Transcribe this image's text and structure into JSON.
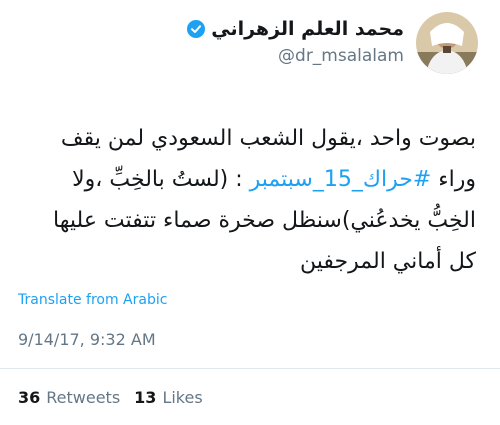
{
  "author": {
    "display_name": "محمد العلم الزهراني",
    "handle": "@dr_msalalam",
    "verified": true,
    "avatar_icon": "profile-photo"
  },
  "tweet": {
    "text_before_hashtag": "بصوت واحد ،يقول الشعب السعودي لمن يقف وراء",
    "hashtag": "#حراك_15_سبتمبر",
    "text_after_hashtag": ": (لستُ بالخِبِّ ،ولا الخِبُّ يخدعُني)سنظل صخرة صماء تتفتت عليها كل أماني المرجفين"
  },
  "translate_label": "Translate from Arabic",
  "timestamp": "9/14/17, 9:32 AM",
  "stats": {
    "retweets_count": "36",
    "retweets_label": "Retweets",
    "likes_count": "13",
    "likes_label": "Likes"
  },
  "colors": {
    "link": "#1da1f2",
    "secondary_text": "#657786",
    "primary_text": "#14171a"
  }
}
